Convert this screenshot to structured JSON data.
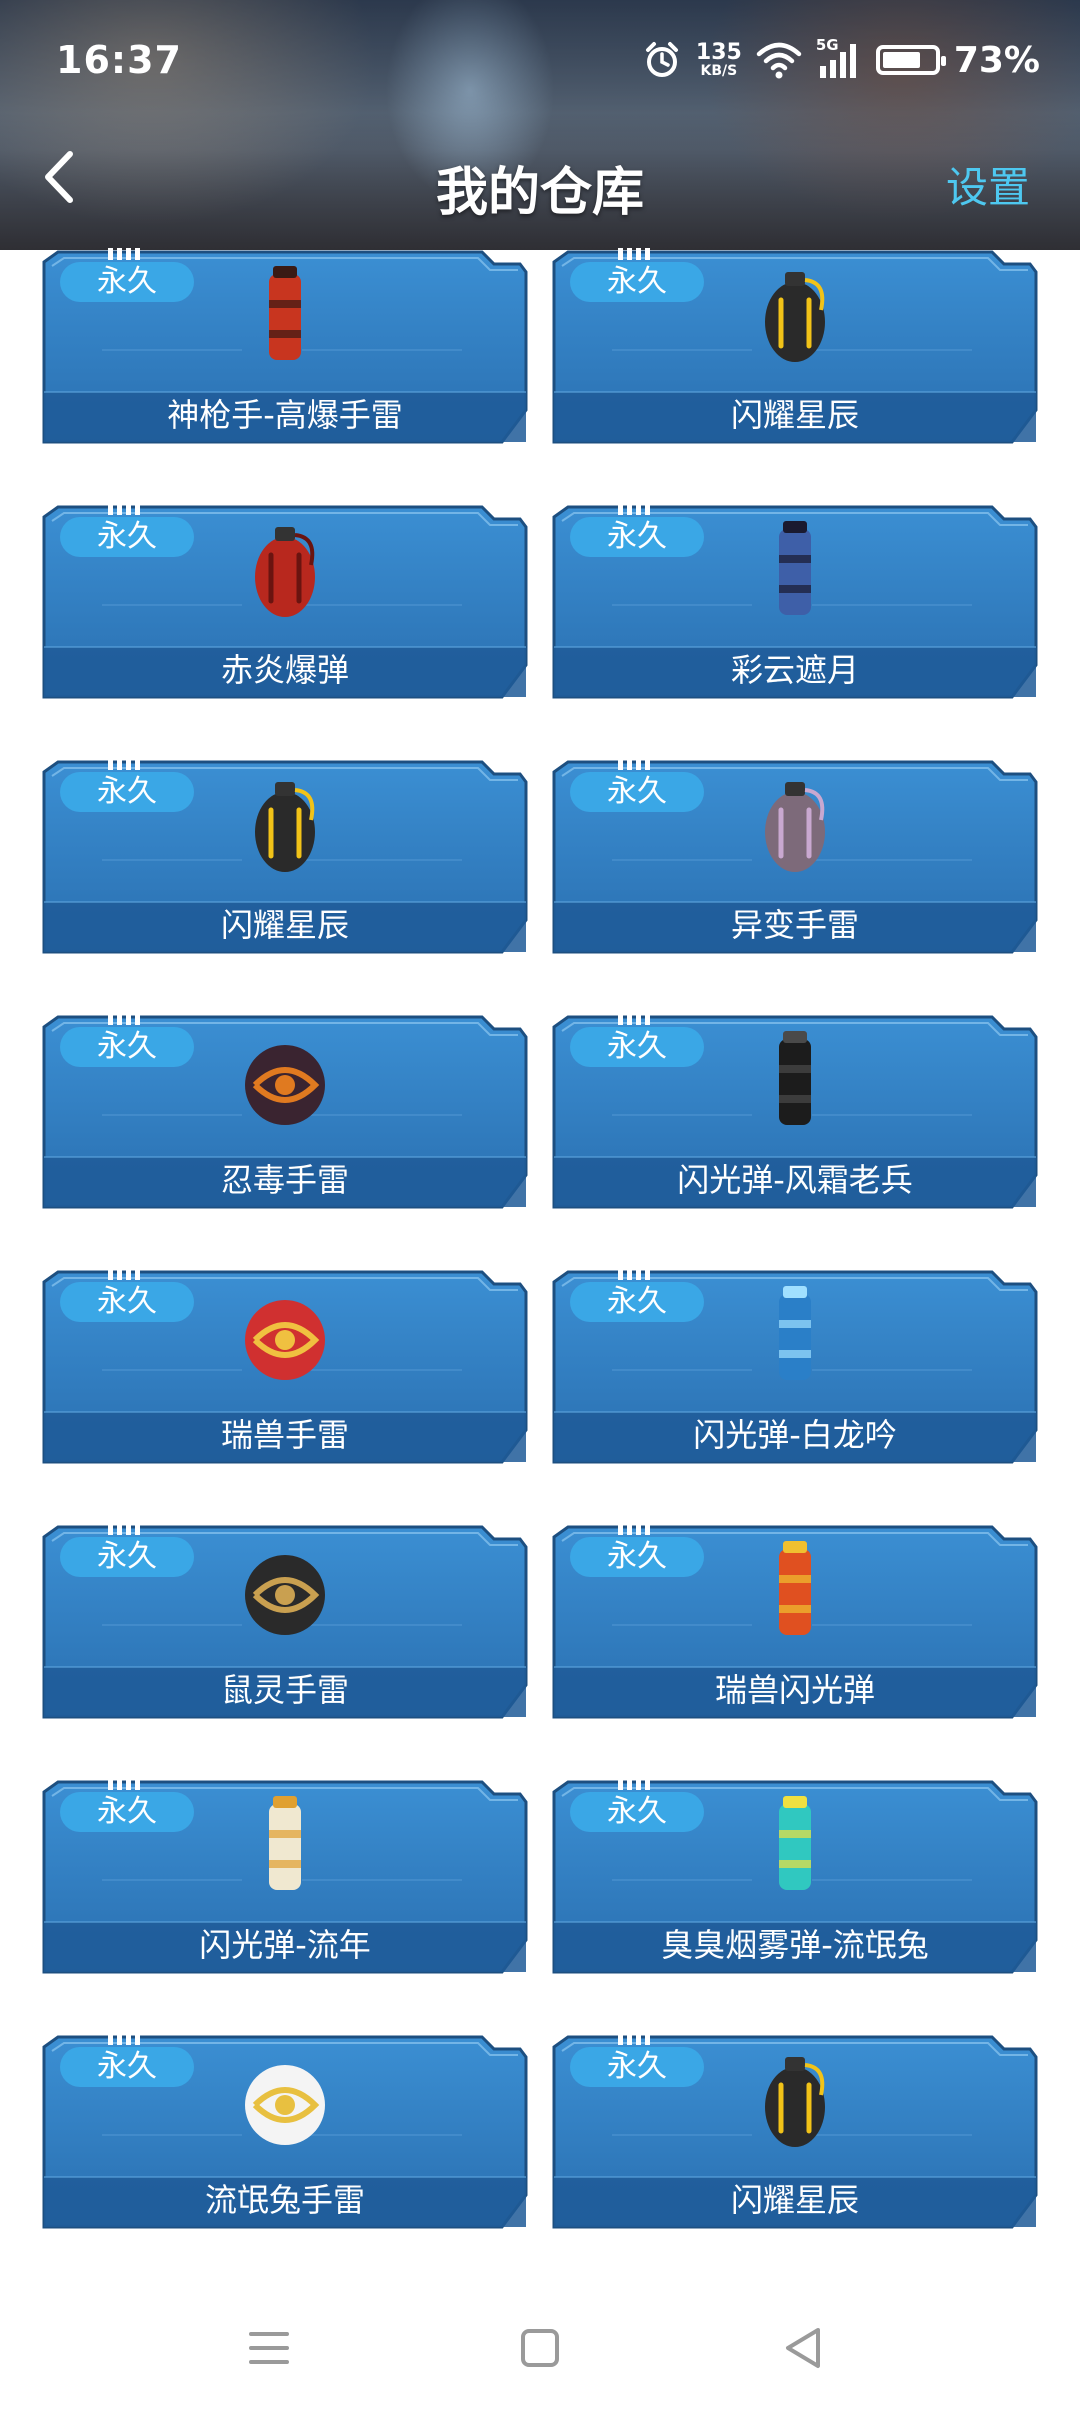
{
  "status_bar": {
    "time": "16:37",
    "net_speed_value": "135",
    "net_speed_unit": "KB/S",
    "network_type": "5G",
    "battery_percent": "73%",
    "battery_level": 0.73,
    "icons": [
      "alarm-icon",
      "wifi-icon",
      "signal-icon",
      "battery-icon"
    ]
  },
  "header": {
    "title": "我的仓库",
    "settings_label": "设置",
    "back_icon": "chevron-left-icon"
  },
  "items": [
    {
      "badge": "永久",
      "name": "神枪手-高爆手雷"
    },
    {
      "badge": "永久",
      "name": "闪耀星辰"
    },
    {
      "badge": "永久",
      "name": "赤炎爆弹"
    },
    {
      "badge": "永久",
      "name": "彩云遮月"
    },
    {
      "badge": "永久",
      "name": "闪耀星辰"
    },
    {
      "badge": "永久",
      "name": "异变手雷"
    },
    {
      "badge": "永久",
      "name": "忍毒手雷"
    },
    {
      "badge": "永久",
      "name": "闪光弹-风霜老兵"
    },
    {
      "badge": "永久",
      "name": "瑞兽手雷"
    },
    {
      "badge": "永久",
      "name": "闪光弹-白龙吟"
    },
    {
      "badge": "永久",
      "name": "鼠灵手雷"
    },
    {
      "badge": "永久",
      "name": "瑞兽闪光弹"
    },
    {
      "badge": "永久",
      "name": "闪光弹-流年"
    },
    {
      "badge": "永久",
      "name": "臭臭烟雾弹-流氓兔"
    },
    {
      "badge": "永久",
      "name": "流氓兔手雷"
    },
    {
      "badge": "永久",
      "name": "闪耀星辰"
    }
  ],
  "system_nav": {
    "icons": [
      "menu-icon",
      "home-square-icon",
      "back-triangle-icon"
    ]
  },
  "colors": {
    "card_blue": "#2e76b6",
    "badge_blue": "#3aa7e6",
    "settings_cyan": "#4ec8f0"
  }
}
